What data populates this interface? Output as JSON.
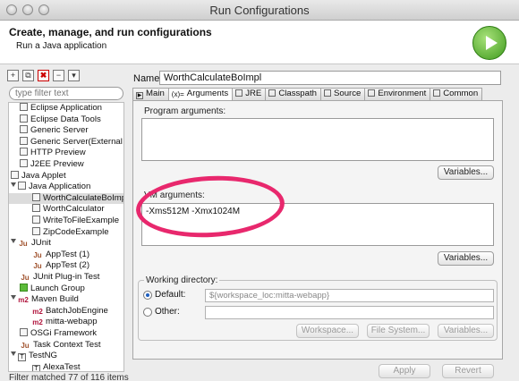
{
  "window": {
    "title": "Run Configurations"
  },
  "header": {
    "title": "Create, manage, and run configurations",
    "subtitle": "Run a Java application",
    "run_icon": "run-play-icon"
  },
  "toolbar": {
    "icons": [
      "new-config-icon",
      "duplicate-icon",
      "delete-icon",
      "collapse-all-icon",
      "filter-menu-icon"
    ],
    "delete_glyph": "✖"
  },
  "filter": {
    "placeholder": "type filter text"
  },
  "tree": {
    "items": [
      {
        "label": "Eclipse Application",
        "indent": 1,
        "icon": "eclipse-app-icon"
      },
      {
        "label": "Eclipse Data Tools",
        "indent": 1,
        "icon": "data-tools-icon"
      },
      {
        "label": "Generic Server",
        "indent": 1,
        "icon": "server-icon"
      },
      {
        "label": "Generic Server(External L",
        "indent": 1,
        "icon": "server-icon"
      },
      {
        "label": "HTTP Preview",
        "indent": 1,
        "icon": "http-preview-icon"
      },
      {
        "label": "J2EE Preview",
        "indent": 1,
        "icon": "j2ee-preview-icon"
      },
      {
        "label": "Java Applet",
        "indent": 0,
        "icon": "java-applet-icon"
      },
      {
        "label": "Java Application",
        "indent": 0,
        "icon": "java-app-icon",
        "expanded": true
      },
      {
        "label": "WorthCalculateBoImpl",
        "indent": 2,
        "icon": "java-config-icon",
        "selected": true
      },
      {
        "label": "WorthCalculator",
        "indent": 2,
        "icon": "java-config-icon"
      },
      {
        "label": "WriteToFileExample",
        "indent": 2,
        "icon": "java-config-icon"
      },
      {
        "label": "ZipCodeExample",
        "indent": 2,
        "icon": "java-config-icon"
      },
      {
        "label": "JUnit",
        "indent": 0,
        "icon": "junit-icon",
        "expanded": true
      },
      {
        "label": "AppTest (1)",
        "indent": 2,
        "icon": "junit-icon"
      },
      {
        "label": "AppTest (2)",
        "indent": 2,
        "icon": "junit-icon"
      },
      {
        "label": "JUnit Plug-in Test",
        "indent": 1,
        "icon": "junit-plugin-icon"
      },
      {
        "label": "Launch Group",
        "indent": 1,
        "icon": "launch-group-icon"
      },
      {
        "label": "Maven Build",
        "indent": 0,
        "icon": "maven-icon",
        "expanded": true
      },
      {
        "label": "BatchJobEngine",
        "indent": 2,
        "icon": "maven-icon"
      },
      {
        "label": "mitta-webapp",
        "indent": 2,
        "icon": "maven-icon"
      },
      {
        "label": "OSGi Framework",
        "indent": 1,
        "icon": "osgi-icon"
      },
      {
        "label": "Task Context Test",
        "indent": 1,
        "icon": "junit-icon"
      },
      {
        "label": "TestNG",
        "indent": 0,
        "icon": "testng-icon",
        "expanded": true
      },
      {
        "label": "AlexaTest",
        "indent": 2,
        "icon": "testng-icon"
      }
    ],
    "status": "Filter matched 77 of 116 items"
  },
  "config": {
    "name_label": "Name:",
    "name_value": "WorthCalculateBoImpl",
    "tabs": [
      {
        "label": "Main",
        "glyph": "▶",
        "icon": "main-tab-icon"
      },
      {
        "label": "Arguments",
        "glyph": "(x)=",
        "icon": "arguments-tab-icon",
        "active": true
      },
      {
        "label": "JRE",
        "glyph": "",
        "icon": "jre-tab-icon"
      },
      {
        "label": "Classpath",
        "glyph": "",
        "icon": "classpath-tab-icon"
      },
      {
        "label": "Source",
        "glyph": "",
        "icon": "source-tab-icon"
      },
      {
        "label": "Environment",
        "glyph": "",
        "icon": "environment-tab-icon"
      },
      {
        "label": "Common",
        "glyph": "",
        "icon": "common-tab-icon"
      }
    ],
    "program_args_label": "Program arguments:",
    "program_args_value": "",
    "vm_args_label": "VM arguments:",
    "vm_args_value": "-Xms512M -Xmx1024M",
    "variables_button": "Variables...",
    "workdir_label": "Working directory:",
    "default_label": "Default:",
    "default_value": "${workspace_loc:mitta-webapp}",
    "other_label": "Other:",
    "other_value": "",
    "workspace_button": "Workspace...",
    "filesystem_button": "File System...",
    "apply_button": "Apply",
    "revert_button": "Revert"
  },
  "annotation": {
    "color": "#e8286d"
  }
}
